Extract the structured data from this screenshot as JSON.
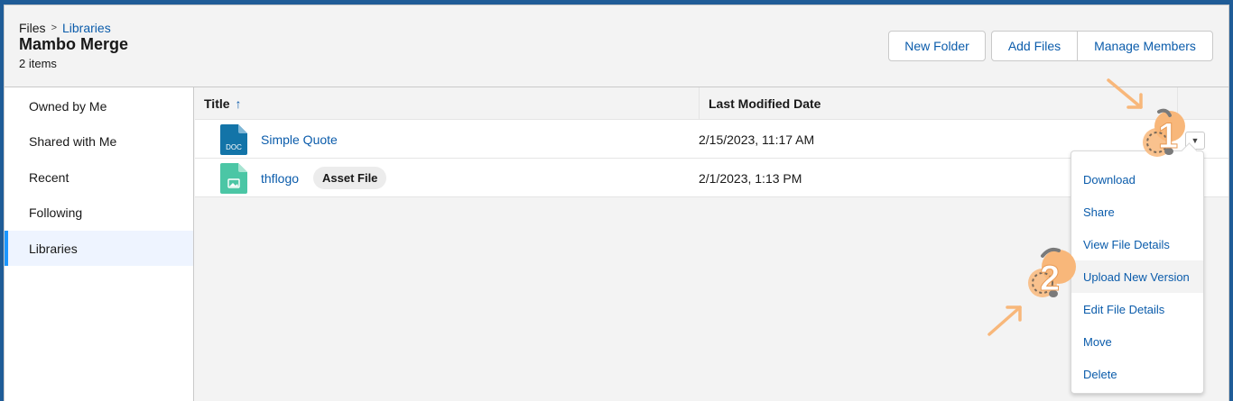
{
  "header": {
    "breadcrumb_root": "Files",
    "breadcrumb_sep": ">",
    "breadcrumb_link": "Libraries",
    "title": "Mambo Merge",
    "item_count": "2 items",
    "buttons": {
      "new_folder": "New Folder",
      "add_files": "Add Files",
      "manage_members": "Manage Members"
    }
  },
  "sidebar": {
    "items": [
      {
        "label": "Owned by Me"
      },
      {
        "label": "Shared with Me"
      },
      {
        "label": "Recent"
      },
      {
        "label": "Following"
      },
      {
        "label": "Libraries"
      }
    ],
    "active": "Libraries"
  },
  "table": {
    "columns": {
      "title": "Title",
      "sort_icon": "arrow-up-icon",
      "date": "Last Modified Date"
    },
    "rows": [
      {
        "title": "Simple Quote",
        "icon": "doc-file-icon",
        "icon_text": "DOC",
        "badge": "",
        "modified": "2/15/2023, 11:17 AM"
      },
      {
        "title": "thflogo",
        "icon": "image-file-icon",
        "badge": "Asset File",
        "modified": "2/1/2023, 1:13 PM"
      }
    ]
  },
  "menu": {
    "items": [
      {
        "label": "Download"
      },
      {
        "label": "Share"
      },
      {
        "label": "View File Details"
      },
      {
        "label": "Upload New Version"
      },
      {
        "label": "Edit File Details"
      },
      {
        "label": "Move"
      },
      {
        "label": "Delete"
      }
    ],
    "highlighted": "Upload New Version"
  },
  "annotations": {
    "step1": "1",
    "step2": "2",
    "accent_color": "#f8b77a",
    "brand_blue": "#0b5cab",
    "doc_icon_color": "#1374a8",
    "image_icon_color": "#4bc6a5"
  }
}
